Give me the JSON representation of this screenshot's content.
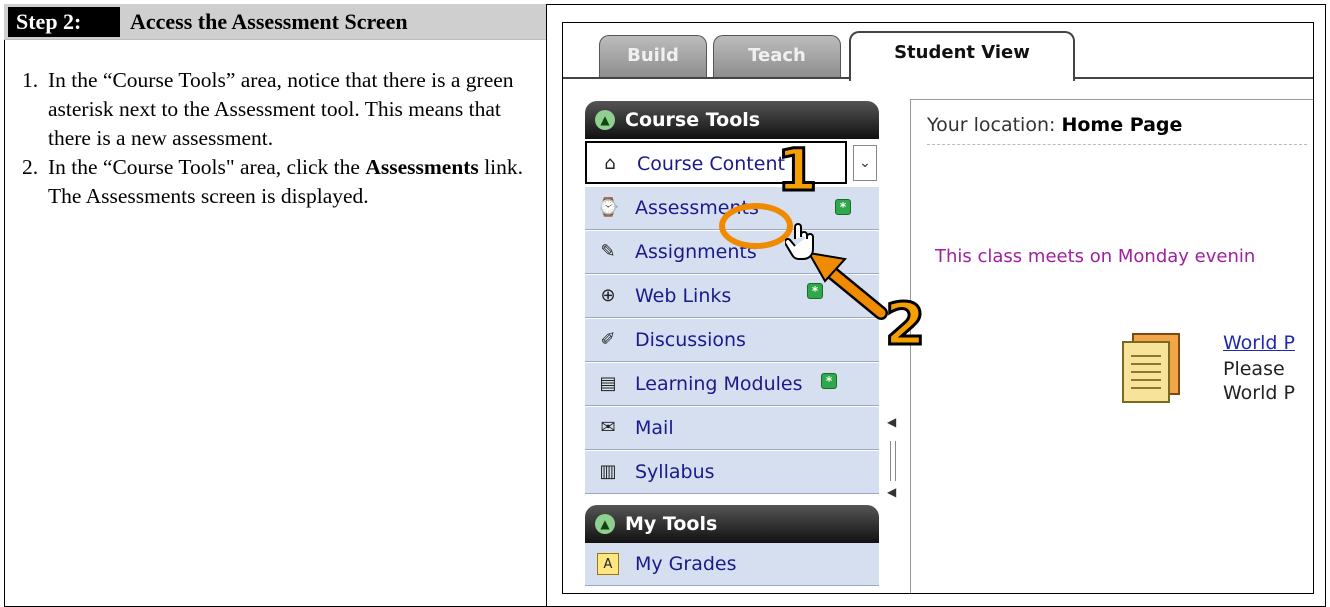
{
  "step": {
    "label": "Step 2:",
    "title": "Access the Assessment Screen",
    "items": [
      {
        "num": "1.",
        "text": "In the “Course Tools” area, notice that there is a green asterisk next to the Assessment tool. This means that there is a new assessment."
      },
      {
        "num": "2.",
        "text_before": "In the “Course Tools\" area, click the ",
        "bold": "Assessments",
        "text_after": " link. The Assessments screen is displayed."
      }
    ]
  },
  "screenshot": {
    "tabs": [
      {
        "label": "Build",
        "active": false
      },
      {
        "label": "Teach",
        "active": false
      },
      {
        "label": "Student View",
        "active": true
      }
    ],
    "course_tools": {
      "header": "Course Tools",
      "items": [
        {
          "label": "Course Content",
          "icon": "home-icon",
          "new": false,
          "selected": true
        },
        {
          "label": "Assessments",
          "icon": "assessment-icon",
          "new": true
        },
        {
          "label": "Assignments",
          "icon": "assignment-icon",
          "new": false
        },
        {
          "label": "Web Links",
          "icon": "globe-icon",
          "new": true
        },
        {
          "label": "Discussions",
          "icon": "pushpin-icon",
          "new": false
        },
        {
          "label": "Learning Modules",
          "icon": "modules-icon",
          "new": true
        },
        {
          "label": "Mail",
          "icon": "mail-icon",
          "new": false
        },
        {
          "label": "Syllabus",
          "icon": "syllabus-icon",
          "new": false
        }
      ]
    },
    "my_tools": {
      "header": "My Tools",
      "items": [
        {
          "label": "My Grades",
          "icon": "grades-icon"
        }
      ]
    },
    "content": {
      "location_label": "Your location:",
      "location_value": "Home Page",
      "message": "This class meets on Monday evenin",
      "link": "World P",
      "desc_line1": "Please",
      "desc_line2": "World P"
    },
    "callouts": [
      "1",
      "2"
    ],
    "colors": {
      "callout": "#f5a000",
      "new_badge": "#2ea84a",
      "sidebar": "#d6dff0",
      "message": "#a020a0"
    }
  }
}
